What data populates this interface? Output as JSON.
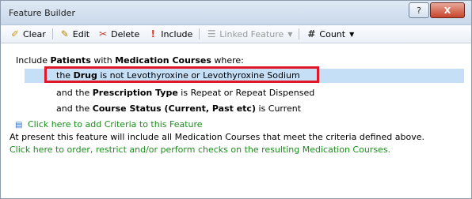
{
  "window": {
    "title": "Feature Builder",
    "help_label": "?",
    "close_label": "X"
  },
  "toolbar": {
    "clear_label": "Clear",
    "edit_label": "Edit",
    "delete_label": "Delete",
    "include_label": "Include",
    "linked_feature_label": "Linked Feature",
    "count_label": "Count"
  },
  "criteria": {
    "intro_prefix": "Include ",
    "intro_patients": "Patients",
    "intro_with": " with ",
    "intro_courses": "Medication Courses",
    "intro_suffix": " where:",
    "c1_prefix": "the ",
    "c1_field": "Drug",
    "c1_rest": " is not Levothyroxine or Levothyroxine Sodium",
    "c2_prefix": "and the ",
    "c2_field": "Prescription Type",
    "c2_rest": " is Repeat or Repeat Dispensed",
    "c3_prefix": "and the ",
    "c3_field": "Course Status (Current, Past etc)",
    "c3_rest": " is Current",
    "add_link": "Click here to add Criteria to this Feature",
    "summary": "At present this feature will include all Medication Courses that meet the criteria defined above.",
    "order_link": "Click here to order, restrict and/or perform checks on the resulting Medication Courses."
  },
  "colors": {
    "highlight": "#c5dff7",
    "annotation_box": "#e0182a",
    "link_green": "#1c8c1c"
  }
}
